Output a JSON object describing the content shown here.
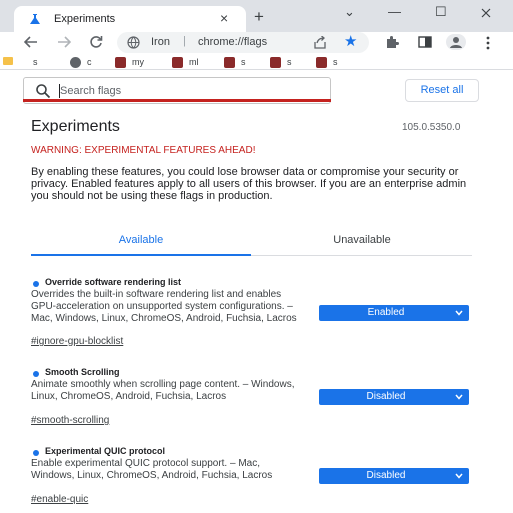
{
  "browser": {
    "tab_title": "Experiments",
    "tab_close": "×",
    "new_tab": "+",
    "window_controls": [
      "⌄",
      "—",
      "☐"
    ],
    "omnibox": {
      "site_label": "Iron",
      "separator": "|",
      "url": "chrome://flags"
    },
    "bookmarks": [
      "s",
      "c",
      "my",
      "ml",
      "s",
      "s",
      "s"
    ]
  },
  "search": {
    "placeholder": "Search flags",
    "value": ""
  },
  "reset_all_label": "Reset all",
  "page": {
    "title": "Experiments",
    "version": "105.0.5350.0",
    "warning": "WARNING: EXPERIMENTAL FEATURES AHEAD!",
    "intro": "By enabling these features, you could lose browser data or compromise your security or privacy. Enabled features apply to all users of this browser. If you are an enterprise admin you should not be using these flags in production."
  },
  "tabs": {
    "available": "Available",
    "unavailable": "Unavailable",
    "active": "available"
  },
  "flags": [
    {
      "name": "Override software rendering list",
      "description": "Overrides the built-in software rendering list and enables GPU-acceleration on unsupported system configurations. – Mac, Windows, Linux, ChromeOS, Android, Fuchsia, Lacros",
      "link": "#ignore-gpu-blocklist",
      "state": "Enabled"
    },
    {
      "name": "Smooth Scrolling",
      "description": "Animate smoothly when scrolling page content. – Windows, Linux, ChromeOS, Android, Fuchsia, Lacros",
      "link": "#smooth-scrolling",
      "state": "Disabled"
    },
    {
      "name": "Experimental QUIC protocol",
      "description": "Enable experimental QUIC protocol support. – Mac, Windows, Linux, ChromeOS, Android, Fuchsia, Lacros",
      "link": "#enable-quic",
      "state": "Disabled"
    }
  ],
  "colors": {
    "accent": "#1a73e8",
    "warning": "#c5221f",
    "chrome_bg": "#dee1e6"
  },
  "icons": {
    "favicon": "flask-icon",
    "back": "arrow-left-icon",
    "forward": "arrow-right-icon",
    "reload": "reload-icon",
    "search": "search-icon",
    "star": "star-icon",
    "extensions": "puzzle-icon",
    "profile": "avatar-icon",
    "menu": "kebab-menu-icon"
  }
}
